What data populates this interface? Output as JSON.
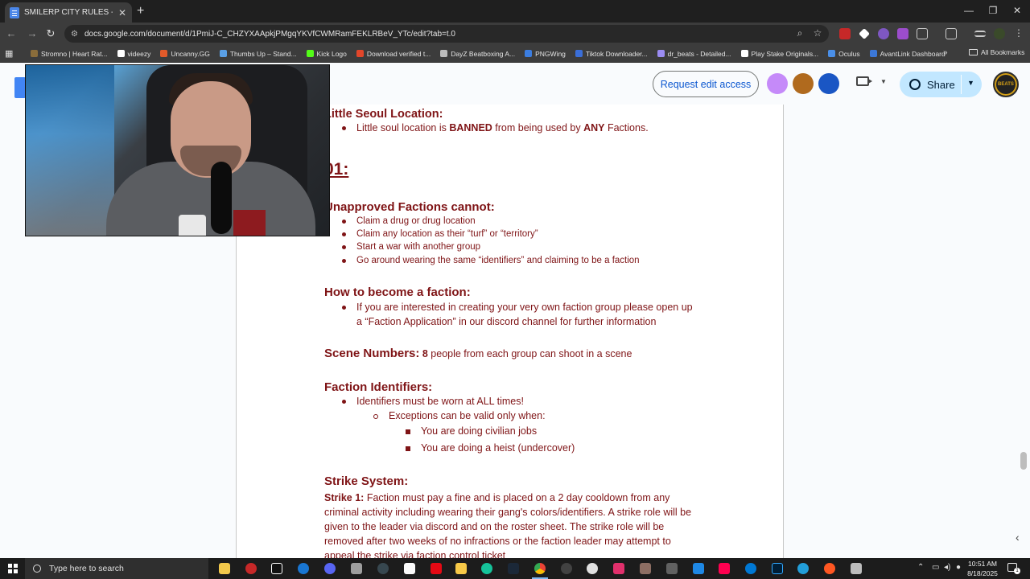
{
  "browser": {
    "tab_title": "SMILERP CITY RULES - Google",
    "tab_close": "✕",
    "new_tab": "+",
    "url": "docs.google.com/document/d/1PmiJ-C_CHZYXAApkjPMgqYKVfCWMRamFEKLRBeV_YTc/edit?tab=t.0",
    "window_controls": [
      "—",
      "❐",
      "✕"
    ]
  },
  "bookmarks": {
    "items": [
      {
        "label": "Stromno | Heart Rat...",
        "color": "#8a6d3b"
      },
      {
        "label": "videezy",
        "color": "#ffffff"
      },
      {
        "label": "Uncanny.GG",
        "color": "#e25a2a"
      },
      {
        "label": "Thumbs Up – Stand...",
        "color": "#5aa0e6"
      },
      {
        "label": "Kick Logo",
        "color": "#53fc18"
      },
      {
        "label": "Download verified t...",
        "color": "#e2462a"
      },
      {
        "label": "DayZ Beatboxing A...",
        "color": "#bbbbbb"
      },
      {
        "label": "PNGWing",
        "color": "#3b7de0"
      },
      {
        "label": "Tiktok Downloader...",
        "color": "#3a6ed8"
      },
      {
        "label": "dr_beats - Detailed...",
        "color": "#9b8cf2"
      },
      {
        "label": "Play Stake Originals...",
        "color": "#ffffff"
      },
      {
        "label": "Oculus",
        "color": "#4a8fe8"
      },
      {
        "label": "AvantLink Dashboard",
        "color": "#3c78d8"
      }
    ],
    "more": "»",
    "all_bookmarks": "All Bookmarks"
  },
  "docs_header": {
    "request_edit": "Request edit access",
    "share": "Share",
    "user_badge": "BEATS",
    "collaborator_colors": [
      "#c58af9",
      "#b06a1e",
      "#1a56c4"
    ]
  },
  "document": {
    "little_seoul_heading": "Little Seoul Location:",
    "little_seoul_item": {
      "pre": "Little soul location is ",
      "b1": "BANNED",
      "mid": " from being used by ",
      "b2": "ANY",
      "post": " Factions."
    },
    "section_num": "01:",
    "unapproved_heading": "Unapproved Factions cannot:",
    "unapproved_items": [
      "Claim a drug or drug location",
      "Claim any location as their “turf” or “territory”",
      "Start a war with another group",
      "Go around wearing the same “identifiers” and claiming to be a faction"
    ],
    "become_heading": "How to become a faction:",
    "become_item_line1": "If you are interested in creating your very own faction group please open up",
    "become_item_line2": "a “Faction Application” in our discord channel for further information",
    "scene_heading": "Scene Numbers:",
    "scene_number": "8",
    "scene_text": " people from each group can shoot in a scene",
    "identifiers_heading": "Faction Identifiers:",
    "identifiers_item": "Identifiers must be worn at ALL times!",
    "exceptions_item": "Exceptions can be valid only when:",
    "exception_cases": [
      "You are doing civilian jobs",
      "You are doing a heist (undercover)"
    ],
    "strike_heading": "Strike System:",
    "strike1_label": "Strike 1:",
    "strike1_lines": [
      " Faction must pay a fine and is placed on a 2 day cooldown from any",
      "criminal activity including wearing their gang's colors/identifiers. A strike role will be",
      "given to the leader via discord and on the roster sheet. The strike role will be",
      "removed after two weeks of no infractions or the faction leader may attempt to",
      "appeal the strike via faction control ticket"
    ]
  },
  "taskbar": {
    "search_placeholder": "Type here to search",
    "time": "10:51 AM",
    "date": "8/18/2025",
    "notification_count": "1"
  }
}
